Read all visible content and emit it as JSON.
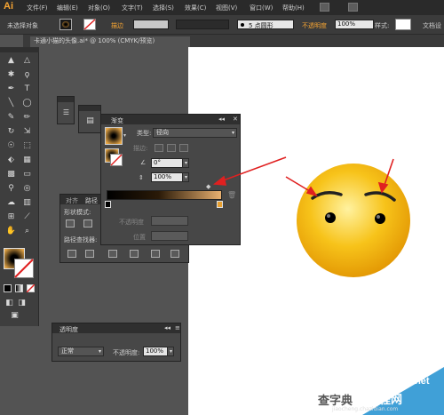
{
  "app": {
    "logo_text": "Ai"
  },
  "menu": [
    "文件(F)",
    "编辑(E)",
    "对象(O)",
    "文字(T)",
    "选择(S)",
    "效果(C)",
    "视图(V)",
    "窗口(W)",
    "帮助(H)"
  ],
  "control_bar": {
    "selection_label": "未选择对象",
    "stroke_label": "描边",
    "brush_label": "5 点圆形",
    "opacity_label": "不透明度",
    "opacity_value": "100%",
    "style_label": "样式:",
    "workspace_label": "文档设"
  },
  "document": {
    "tab_title": "卡通小猫的头像.ai* @ 100% (CMYK/预览)"
  },
  "gradient_panel": {
    "tab": "渐变",
    "type_label": "类型:",
    "type_value": "径向",
    "stroke_label": "描边:",
    "angle_value": "0°",
    "aspect_value": "100%",
    "opacity_label": "不透明度",
    "location_label": "位置",
    "colors": {
      "start": "#000000",
      "end": "#e8b070"
    }
  },
  "pathfinder_panel": {
    "tabs": [
      "对齐",
      "路径"
    ],
    "shape_modes_label": "形状模式:",
    "pathfinder_label": "路径查找器:"
  },
  "transparency_panel": {
    "tab": "透明度",
    "blend_mode": "正常",
    "opacity_label": "不透明度:",
    "opacity_value": "100%"
  },
  "watermark": {
    "site": "jb51.net",
    "brand_cn": "查字典",
    "brand_cn2": "教程网",
    "url": "jiaocheng.chazidian.com"
  },
  "colors": {
    "menubar": "#2a2a2a",
    "panel": "#474747",
    "face": "#f5b800",
    "arrow": "#e02020"
  }
}
